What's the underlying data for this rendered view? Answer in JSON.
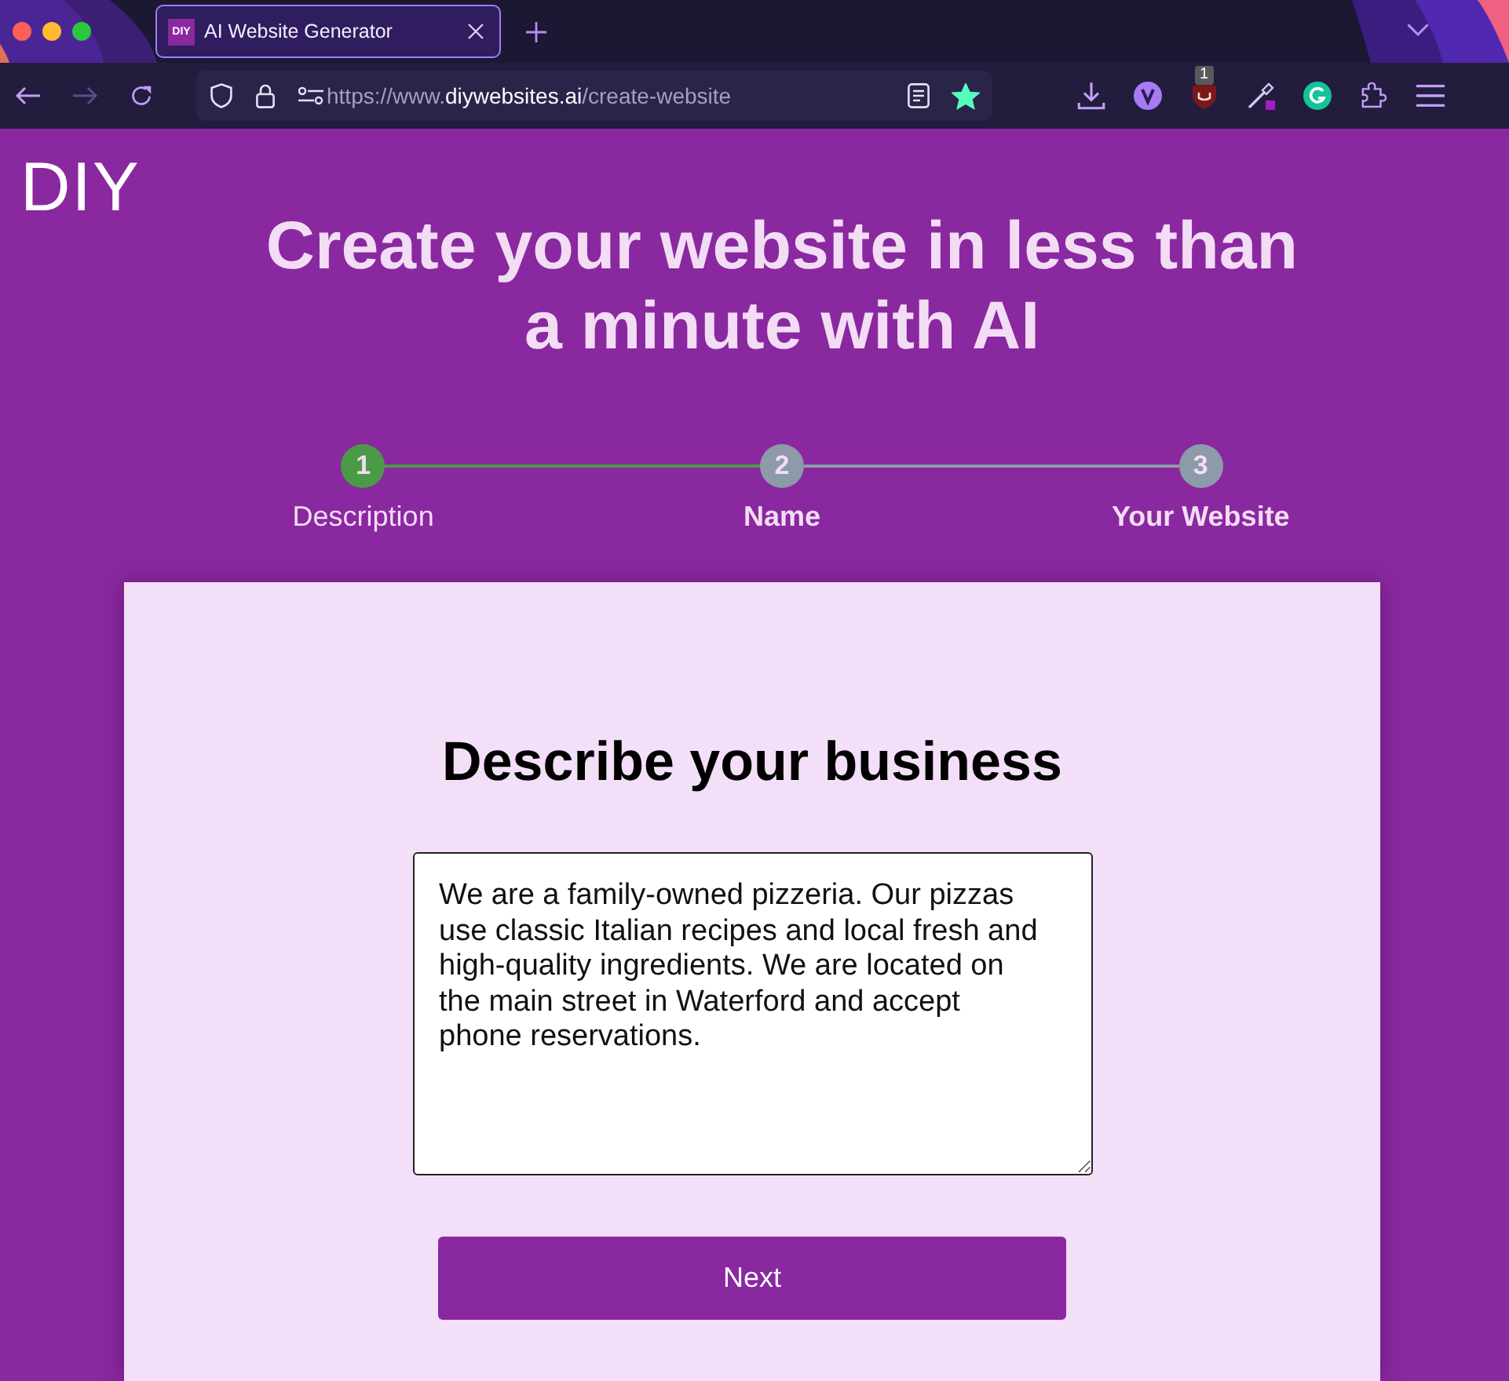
{
  "browser": {
    "tabs": [
      {
        "favicon_text": "DIY",
        "title": "AI Website Generator",
        "selected": true
      }
    ],
    "nav_buttons": [
      {
        "kind": "back",
        "disabled": false
      },
      {
        "kind": "forward",
        "disabled": true
      },
      {
        "kind": "reload",
        "disabled": false
      }
    ],
    "address_bar": {
      "scheme": "https://www.",
      "domain": "diywebsites.ai",
      "path": "/create-website",
      "bookmarked": true
    },
    "extension_badge": "1"
  },
  "page": {
    "logo": "DIY",
    "headline": "Create your website in less than a minute with AI",
    "steps": [
      {
        "number": "1",
        "label": "Description",
        "selected": true
      },
      {
        "number": "2",
        "label": "Name",
        "selected": false
      },
      {
        "number": "3",
        "label": "Your Website",
        "selected": false
      }
    ],
    "form": {
      "title": "Describe your business",
      "description": {
        "value": "We are a family-owned pizzeria. Our pizzas use classic Italian recipes and local fresh and high-quality ingredients. We are located on the main street in Waterford and accept phone reservations."
      },
      "next_button": "Next"
    }
  }
}
